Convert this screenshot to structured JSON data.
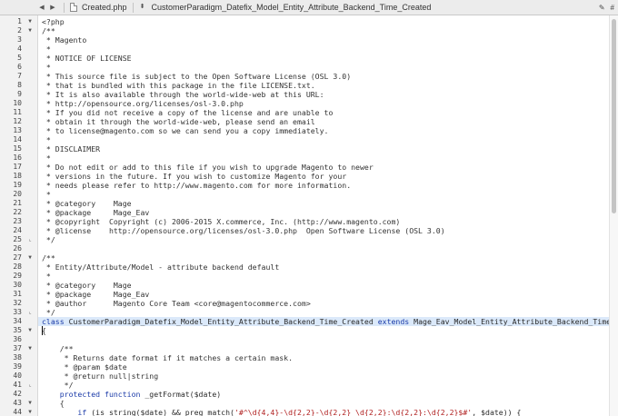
{
  "topbar": {
    "back_glyph": "◀",
    "forward_glyph": "▶",
    "file_name": "Created.php",
    "symbol_toggle_glyph": "⬍",
    "symbol_name": "CustomerParadigm_Datefix_Model_Entity_Attribute_Backend_Time_Created",
    "right_icons": [
      "✎",
      "#"
    ]
  },
  "editor": {
    "highlighted_line": 34,
    "caret_line": 35,
    "lines": [
      {
        "n": "1",
        "fold": "▼",
        "text": "<?php"
      },
      {
        "n": "2",
        "fold": "▼",
        "text": "/**"
      },
      {
        "n": "3",
        "fold": "",
        "text": " * Magento"
      },
      {
        "n": "4",
        "fold": "",
        "text": " *"
      },
      {
        "n": "5",
        "fold": "",
        "text": " * NOTICE OF LICENSE"
      },
      {
        "n": "6",
        "fold": "",
        "text": " *"
      },
      {
        "n": "7",
        "fold": "",
        "text": " * This source file is subject to the Open Software License (OSL 3.0)"
      },
      {
        "n": "8",
        "fold": "",
        "text": " * that is bundled with this package in the file LICENSE.txt."
      },
      {
        "n": "9",
        "fold": "",
        "text": " * It is also available through the world-wide-web at this URL:"
      },
      {
        "n": "10",
        "fold": "",
        "text": " * http://opensource.org/licenses/osl-3.0.php"
      },
      {
        "n": "11",
        "fold": "",
        "text": " * If you did not receive a copy of the license and are unable to"
      },
      {
        "n": "12",
        "fold": "",
        "text": " * obtain it through the world-wide-web, please send an email"
      },
      {
        "n": "13",
        "fold": "",
        "text": " * to license@magento.com so we can send you a copy immediately."
      },
      {
        "n": "14",
        "fold": "",
        "text": " *"
      },
      {
        "n": "15",
        "fold": "",
        "text": " * DISCLAIMER"
      },
      {
        "n": "16",
        "fold": "",
        "text": " *"
      },
      {
        "n": "17",
        "fold": "",
        "text": " * Do not edit or add to this file if you wish to upgrade Magento to newer"
      },
      {
        "n": "18",
        "fold": "",
        "text": " * versions in the future. If you wish to customize Magento for your"
      },
      {
        "n": "19",
        "fold": "",
        "text": " * needs please refer to http://www.magento.com for more information."
      },
      {
        "n": "20",
        "fold": "",
        "text": " *"
      },
      {
        "n": "21",
        "fold": "",
        "text": " * @category    Mage"
      },
      {
        "n": "22",
        "fold": "",
        "text": " * @package     Mage_Eav"
      },
      {
        "n": "23",
        "fold": "",
        "text": " * @copyright  Copyright (c) 2006-2015 X.commerce, Inc. (http://www.magento.com)"
      },
      {
        "n": "24",
        "fold": "",
        "text": " * @license    http://opensource.org/licenses/osl-3.0.php  Open Software License (OSL 3.0)"
      },
      {
        "n": "25",
        "fold": "⌞",
        "text": " */"
      },
      {
        "n": "26",
        "fold": "",
        "text": ""
      },
      {
        "n": "27",
        "fold": "▼",
        "text": "/**"
      },
      {
        "n": "28",
        "fold": "",
        "text": " * Entity/Attribute/Model - attribute backend default"
      },
      {
        "n": "29",
        "fold": "",
        "text": " *"
      },
      {
        "n": "30",
        "fold": "",
        "text": " * @category    Mage"
      },
      {
        "n": "31",
        "fold": "",
        "text": " * @package     Mage_Eav"
      },
      {
        "n": "32",
        "fold": "",
        "text": " * @author      Magento Core Team <core@magentocommerce.com>"
      },
      {
        "n": "33",
        "fold": "⌞",
        "text": " */"
      },
      {
        "n": "34",
        "fold": "",
        "kw1": "class",
        "mid": " CustomerParadigm_Datefix_Model_Entity_Attribute_Backend_Time_Created ",
        "kw2": "extends",
        "tail": " Mage_Eav_Model_Entity_Attribute_Backend_Time_Cre"
      },
      {
        "n": "35",
        "fold": "▼",
        "text": "{"
      },
      {
        "n": "36",
        "fold": "",
        "text": ""
      },
      {
        "n": "37",
        "fold": "▼",
        "text": "    /**"
      },
      {
        "n": "38",
        "fold": "",
        "text": "     * Returns date format if it matches a certain mask."
      },
      {
        "n": "39",
        "fold": "",
        "text": "     * @param $date"
      },
      {
        "n": "40",
        "fold": "",
        "text": "     * @return null|string"
      },
      {
        "n": "41",
        "fold": "⌞",
        "text": "     */"
      },
      {
        "n": "42",
        "fold": "",
        "kw1": "    protected function",
        "mid": " _getFormat($date)"
      },
      {
        "n": "43",
        "fold": "▼",
        "text": "    {"
      },
      {
        "n": "44",
        "fold": "▼",
        "kw1": "        if",
        "mid": " (is_string($date) && preg_match(",
        "str": "'#^\\d{4,4}-\\d{2,2}-\\d{2,2} \\d{2,2}:\\d{2,2}:\\d{2,2}$#'",
        "tail": ", $date)) {"
      }
    ]
  }
}
